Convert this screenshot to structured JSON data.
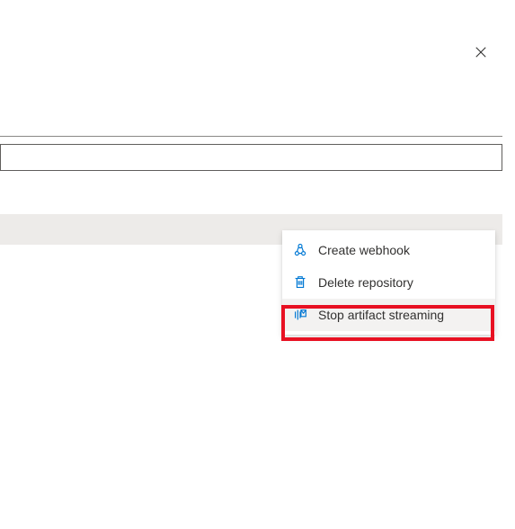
{
  "close_aria": "Close",
  "input": {
    "value": ""
  },
  "menu": {
    "items": [
      {
        "label": "Create webhook",
        "icon": "webhook"
      },
      {
        "label": "Delete repository",
        "icon": "delete"
      },
      {
        "label": "Stop artifact streaming",
        "icon": "stream"
      }
    ]
  },
  "colors": {
    "accent": "#0078d4",
    "highlight": "#e81123"
  }
}
